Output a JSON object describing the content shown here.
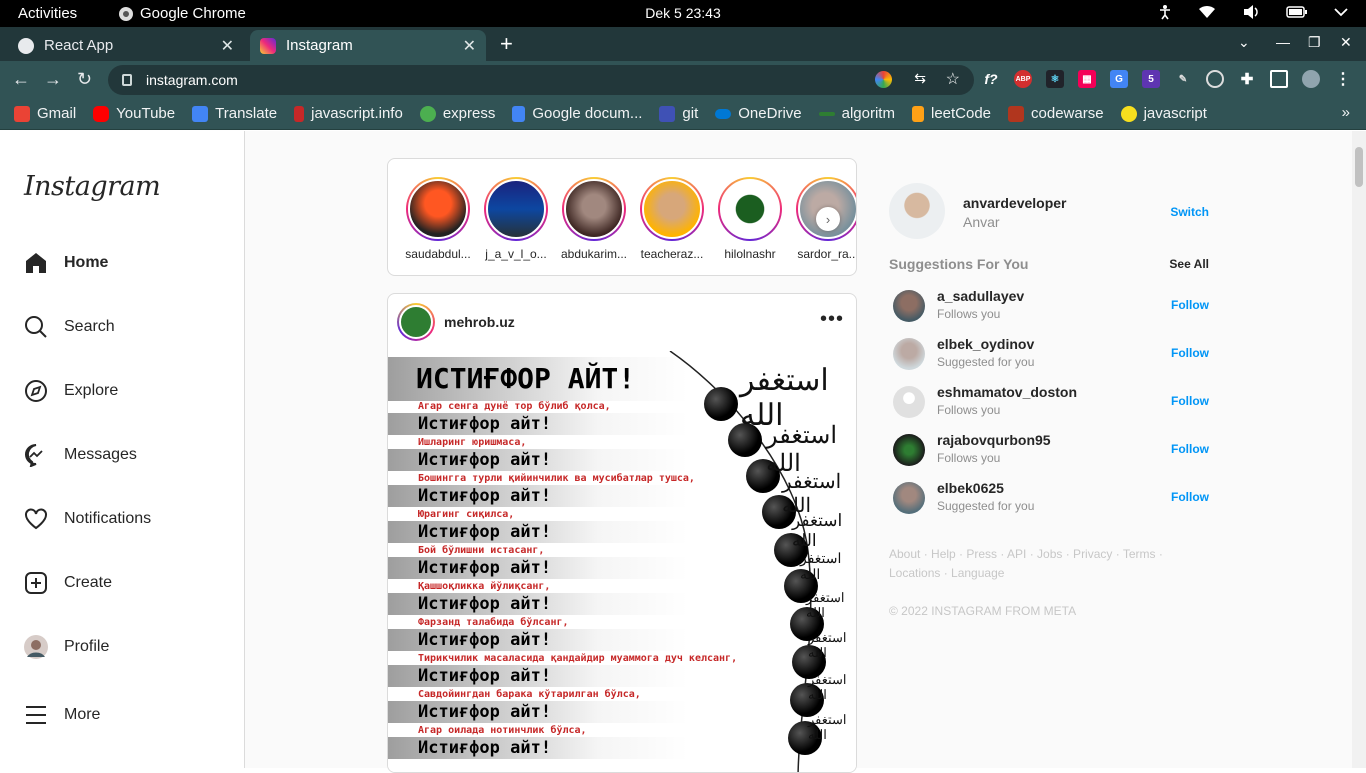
{
  "os": {
    "activities": "Activities",
    "app": "Google Chrome",
    "clock": "Dek 5  23:43"
  },
  "tabs": [
    {
      "title": "React App",
      "active": false
    },
    {
      "title": "Instagram",
      "active": true
    }
  ],
  "url": "instagram.com",
  "bookmarks": [
    "Gmail",
    "YouTube",
    "Translate",
    "javascript.info",
    "express",
    "Google docum...",
    "git",
    "OneDrive",
    "algoritm",
    "leetCode",
    "codewarse",
    "javascript"
  ],
  "sidebar": {
    "logo": "Instagram",
    "items": [
      {
        "label": "Home",
        "icon": "home-icon"
      },
      {
        "label": "Search",
        "icon": "search-icon"
      },
      {
        "label": "Explore",
        "icon": "compass-icon"
      },
      {
        "label": "Messages",
        "icon": "messenger-icon"
      },
      {
        "label": "Notifications",
        "icon": "heart-icon"
      },
      {
        "label": "Create",
        "icon": "plus-square-icon"
      },
      {
        "label": "Profile",
        "icon": "avatar"
      },
      {
        "label": "More",
        "icon": "menu-icon"
      }
    ]
  },
  "stories": [
    "saudabdul...",
    "j_a_v_l_o...",
    "abdukarim...",
    "teacheraz...",
    "hilolnashr",
    "sardor_ra..."
  ],
  "post": {
    "user": "mehrob.uz",
    "title": "ИСТИҒФОР АЙТ!",
    "refrain": "Истиғфор айт!",
    "lines": [
      "Агар сенга дунё тор бўлиб қолса,",
      "Ишларинг юришмаса,",
      "Бошингга турли қийинчилик ва мусибатлар тушса,",
      "Юрагинг сиқилса,",
      "Бой бўлишни истасанг,",
      "Қашшоқликка йўлиқсанг,",
      "Фарзанд талабида бўлсанг,",
      "Тирикчилик масаласида қандайдир муаммога дуч келсанг,",
      "Савдойингдан барака кўтарилган бўлса,",
      "Агар оилада нотинчлик бўлса,"
    ],
    "arabic": "استغفر الله"
  },
  "me": {
    "username": "anvardeveloper",
    "name": "Anvar",
    "switch": "Switch"
  },
  "suggestions": {
    "heading": "Suggestions For You",
    "see_all": "See All",
    "follow": "Follow",
    "items": [
      {
        "user": "a_sadullayev",
        "sub": "Follows you"
      },
      {
        "user": "elbek_oydinov",
        "sub": "Suggested for you"
      },
      {
        "user": "eshmamatov_doston",
        "sub": "Follows you"
      },
      {
        "user": "rajabovqurbon95",
        "sub": "Follows you"
      },
      {
        "user": "elbek0625",
        "sub": "Suggested for you"
      }
    ]
  },
  "footer": {
    "links1": "About · Help · Press · API · Jobs · Privacy · Terms ·",
    "links2": "Locations · Language",
    "copyright": "© 2022 INSTAGRAM FROM META"
  }
}
